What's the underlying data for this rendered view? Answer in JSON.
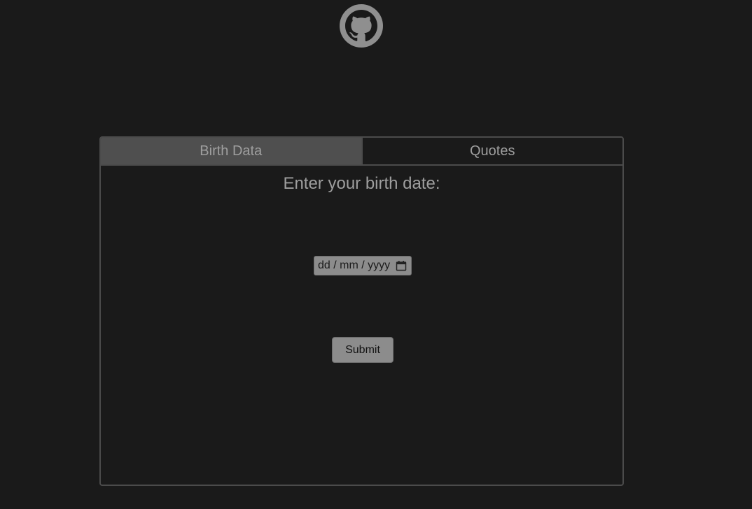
{
  "header": {
    "logo_icon": "github-octocat-icon"
  },
  "tabs": [
    {
      "label": "Birth Data",
      "active": true
    },
    {
      "label": "Quotes",
      "active": false
    }
  ],
  "form": {
    "heading": "Enter your birth date:",
    "date_input": {
      "placeholder": "dd / mm / yyyy",
      "value": "",
      "icon": "calendar-icon"
    },
    "submit_label": "Submit"
  },
  "colors": {
    "background": "#1a1a1a",
    "panel_border": "#4b4b4b",
    "active_tab": "#4f4f4f",
    "text": "#9e9e9e",
    "control": "#8c8c8c"
  }
}
